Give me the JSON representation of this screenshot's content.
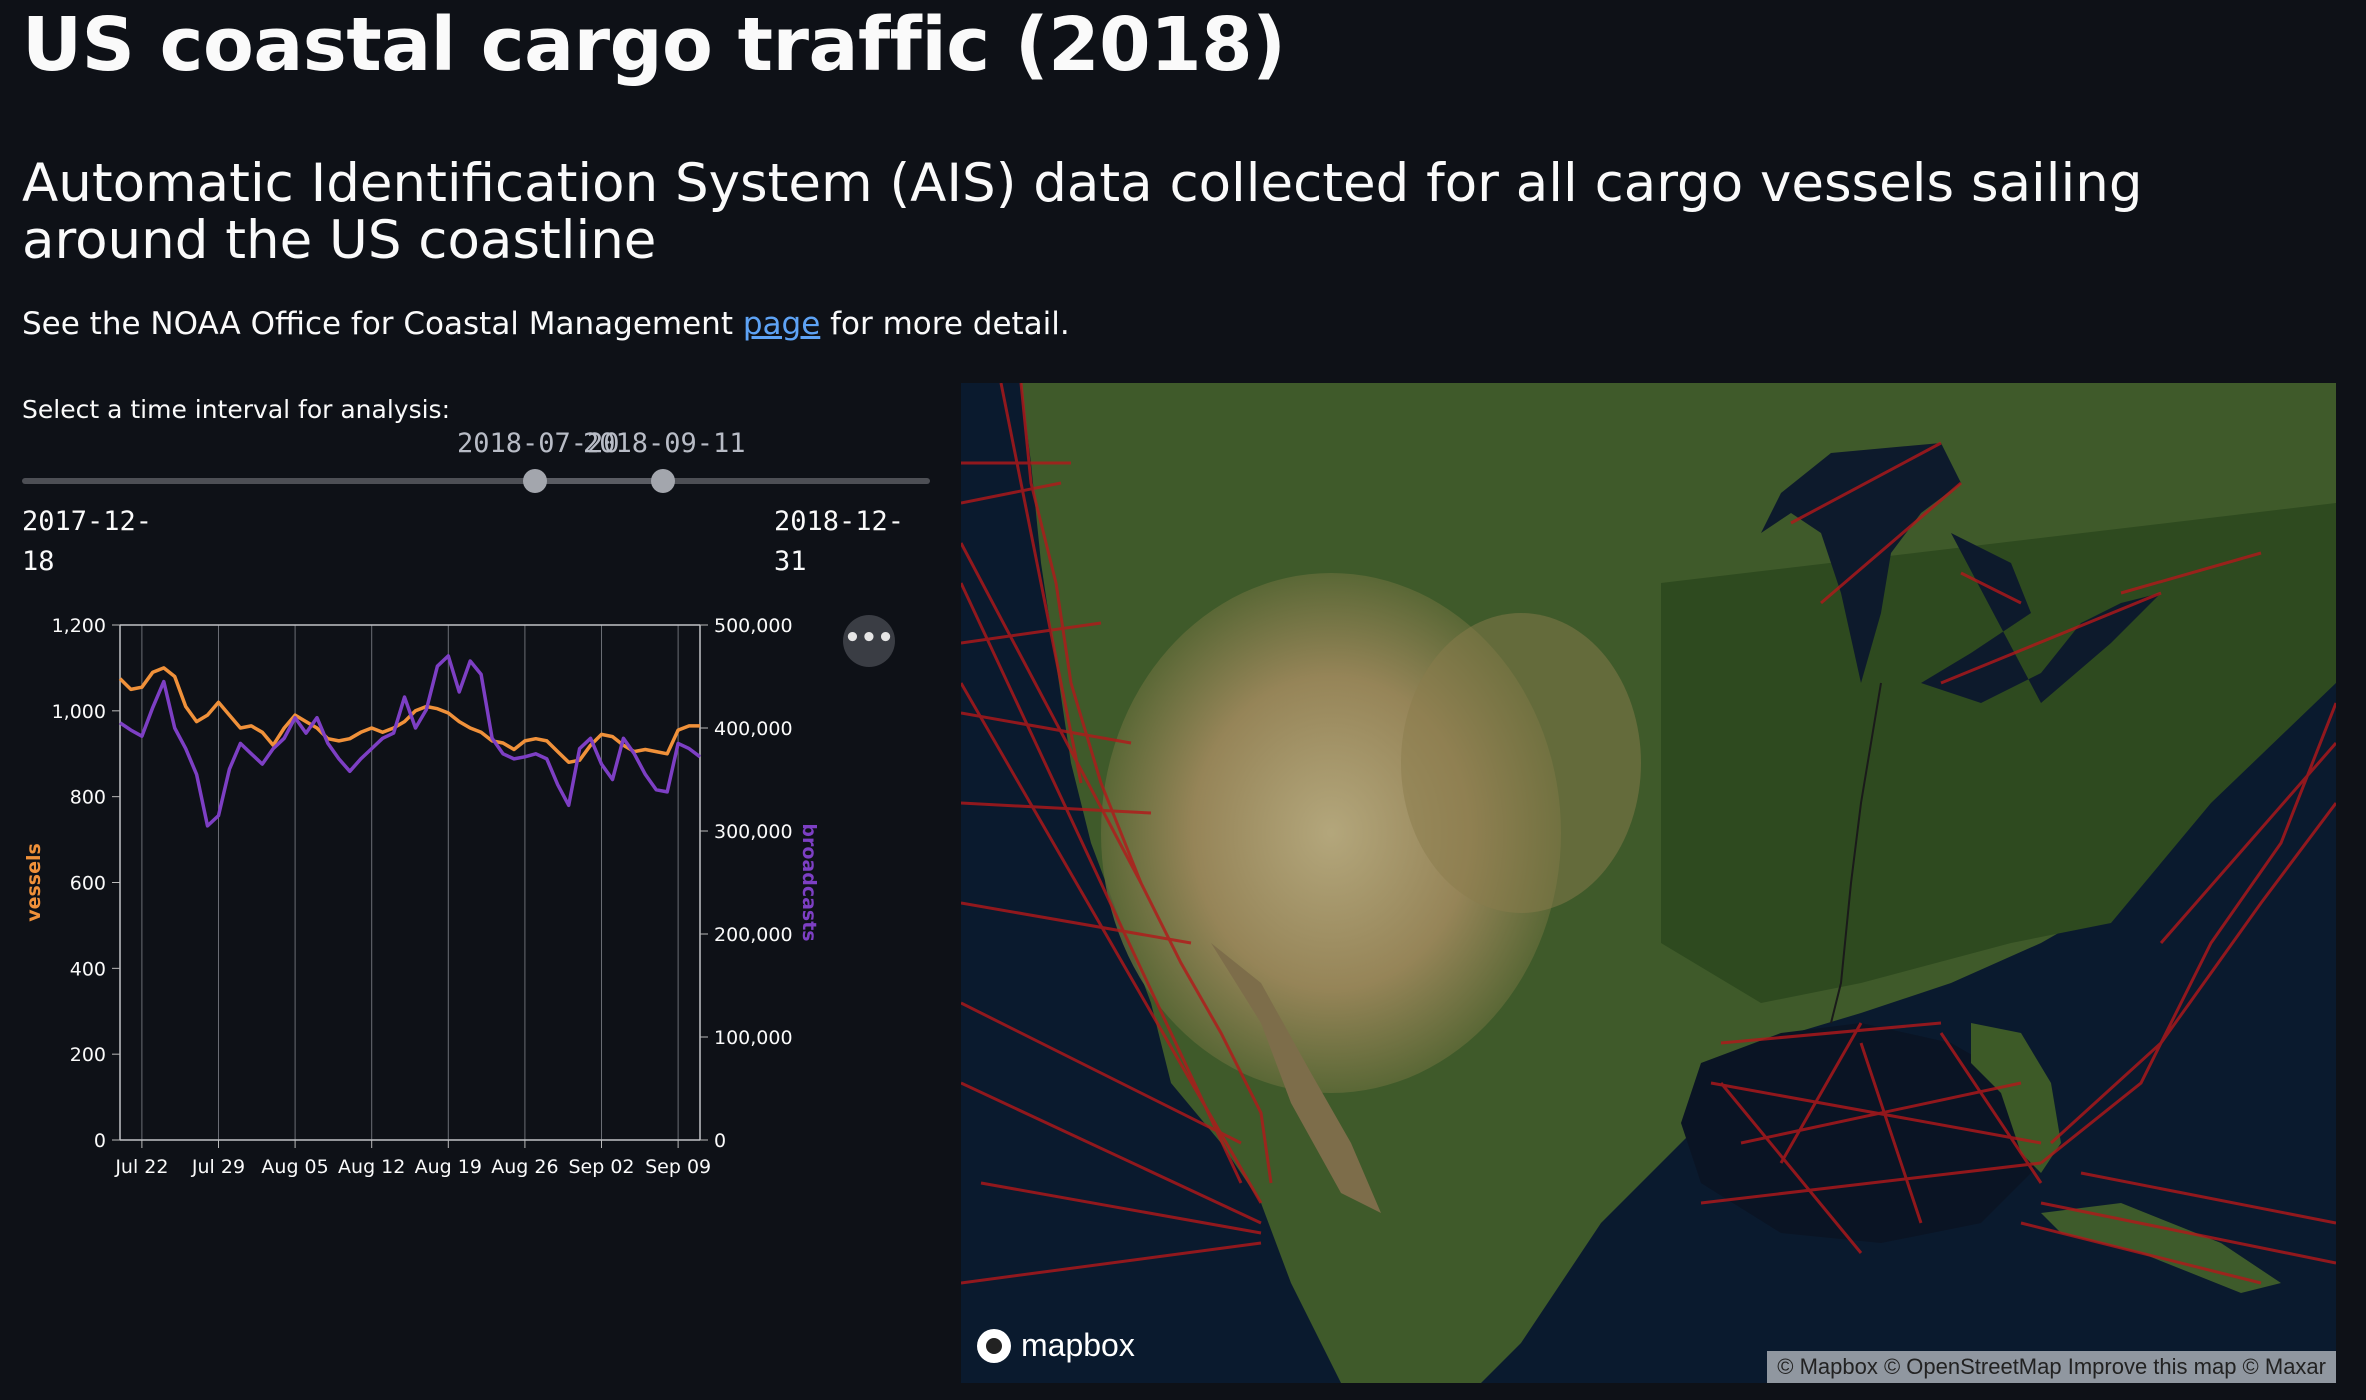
{
  "page": {
    "title": "US coastal cargo traffic (2018)",
    "subtitle": "Automatic Identification System (AIS) data collected for all cargo vessels sailing around the US coastline",
    "para_before": "See the NOAA Office for Coastal Management ",
    "para_link": "page",
    "para_after": " for more detail."
  },
  "slider": {
    "label": "Select a time interval for analysis:",
    "value_start": "2018-07-20",
    "value_end": "2018-09-11",
    "min": "2017-12-18",
    "min_line1": "2017-12-",
    "min_line2": "18",
    "max": "2018-12-31",
    "max_line1": "2018-12-",
    "max_line2": "31",
    "selection_start_fraction": 0.566,
    "selection_end_fraction": 0.706
  },
  "chart_menu": {
    "label": "•••"
  },
  "chart_data": {
    "type": "line",
    "x_ticks": [
      "Jul 22",
      "Jul 29",
      "Aug 05",
      "Aug 12",
      "Aug 19",
      "Aug 26",
      "Sep 02",
      "Sep 09"
    ],
    "x_tick_days": [
      2,
      9,
      16,
      23,
      30,
      37,
      44,
      51
    ],
    "x_range_days": [
      0,
      53
    ],
    "y_left_label": "vessels",
    "y_left_ticks": [
      "0",
      "200",
      "400",
      "600",
      "800",
      "1,000",
      "1,200"
    ],
    "y_left_range": [
      0,
      1200
    ],
    "y_right_label": "broadcasts",
    "y_right_ticks": [
      "0",
      "100,000",
      "200,000",
      "300,000",
      "400,000",
      "500,000"
    ],
    "y_right_range": [
      0,
      500000
    ],
    "series": [
      {
        "name": "vessels",
        "color": "#f0913a",
        "x": [
          0,
          1,
          2,
          3,
          4,
          5,
          6,
          7,
          8,
          9,
          10,
          11,
          12,
          13,
          14,
          15,
          16,
          17,
          18,
          19,
          20,
          21,
          22,
          23,
          24,
          25,
          26,
          27,
          28,
          29,
          30,
          31,
          32,
          33,
          34,
          35,
          36,
          37,
          38,
          39,
          40,
          41,
          42,
          43,
          44,
          45,
          46,
          47,
          48,
          49,
          50,
          51,
          52,
          53
        ],
        "y": [
          1075,
          1050,
          1055,
          1090,
          1100,
          1080,
          1010,
          975,
          990,
          1020,
          990,
          960,
          965,
          950,
          920,
          960,
          990,
          975,
          960,
          935,
          930,
          935,
          950,
          960,
          950,
          960,
          975,
          1000,
          1010,
          1005,
          995,
          975,
          960,
          950,
          930,
          925,
          910,
          930,
          935,
          930,
          905,
          880,
          885,
          920,
          945,
          940,
          920,
          905,
          910,
          905,
          900,
          955,
          965,
          965
        ]
      },
      {
        "name": "broadcasts",
        "color": "#7d3fc4",
        "x": [
          0,
          1,
          2,
          3,
          4,
          5,
          6,
          7,
          8,
          9,
          10,
          11,
          12,
          13,
          14,
          15,
          16,
          17,
          18,
          19,
          20,
          21,
          22,
          23,
          24,
          25,
          26,
          27,
          28,
          29,
          30,
          31,
          32,
          33,
          34,
          35,
          36,
          37,
          38,
          39,
          40,
          41,
          42,
          43,
          44,
          45,
          46,
          47,
          48,
          49,
          50,
          51,
          52,
          53
        ],
        "y": [
          405000,
          398000,
          392000,
          420000,
          445000,
          400000,
          380000,
          355000,
          305000,
          315000,
          360000,
          385000,
          375000,
          365000,
          380000,
          390000,
          410000,
          395000,
          410000,
          385000,
          370000,
          358000,
          370000,
          380000,
          390000,
          395000,
          430000,
          400000,
          418000,
          460000,
          470000,
          435000,
          465000,
          452000,
          390000,
          375000,
          370000,
          372000,
          375000,
          370000,
          345000,
          325000,
          380000,
          390000,
          365000,
          350000,
          390000,
          375000,
          355000,
          340000,
          338000,
          385000,
          380000,
          372000
        ]
      }
    ]
  },
  "map": {
    "logo_text": "mapbox",
    "attribution": "© Mapbox © OpenStreetMap Improve this map © Maxar"
  }
}
